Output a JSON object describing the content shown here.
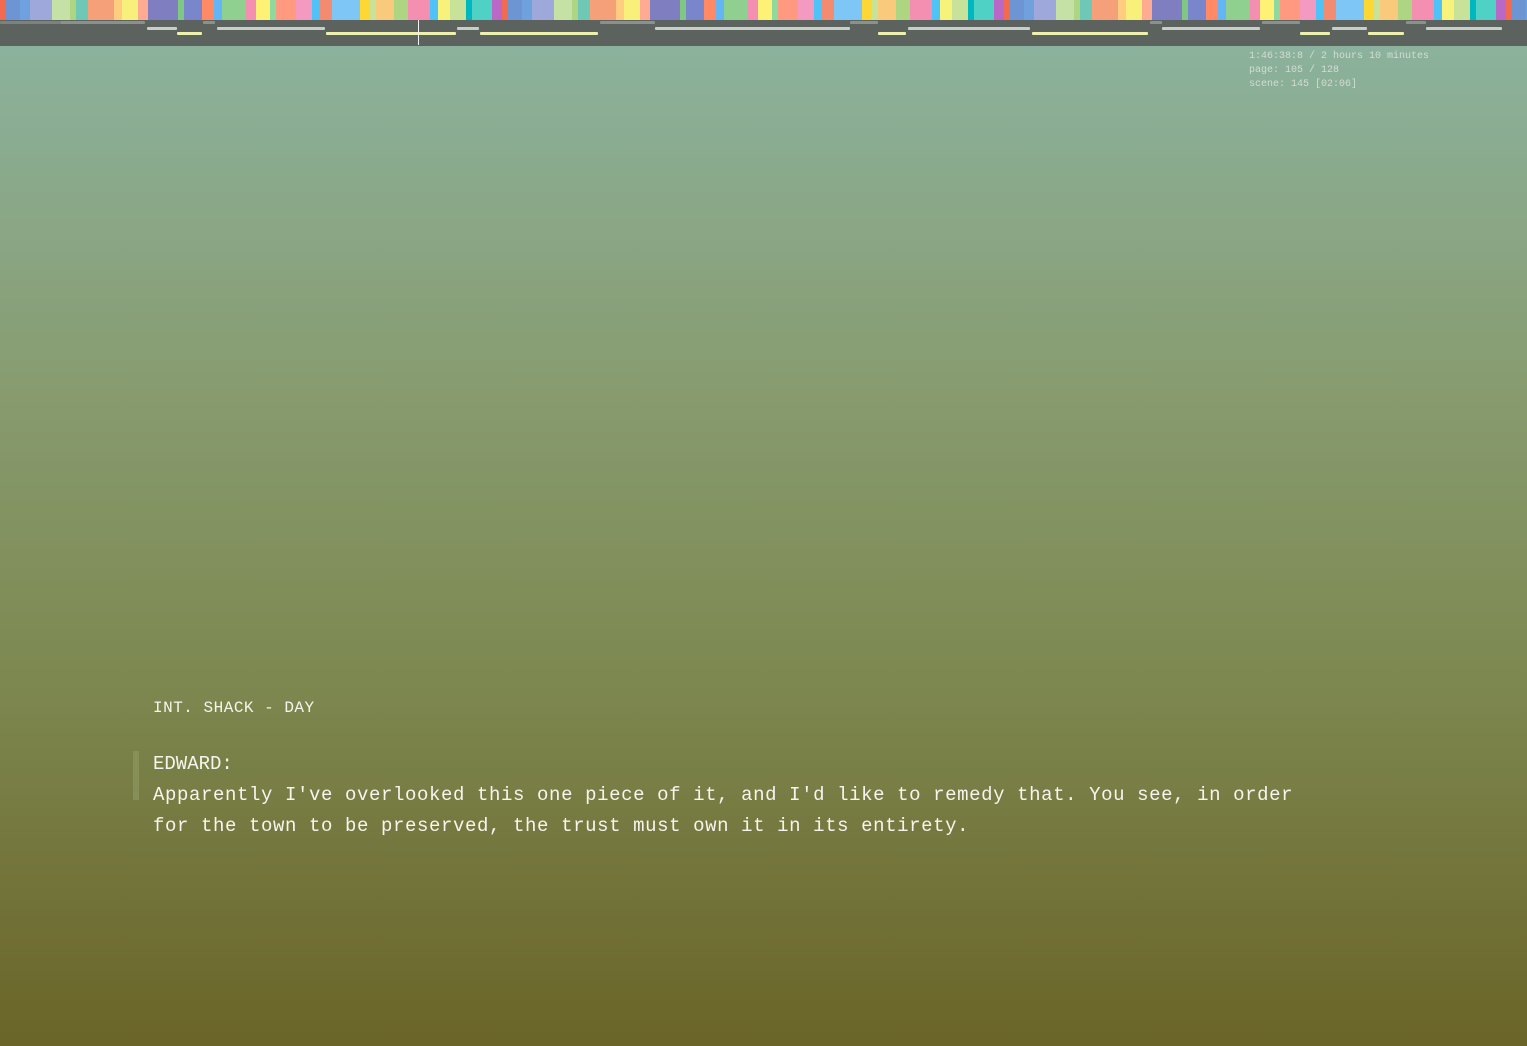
{
  "timeline": {
    "scene_colors": [
      "#f26b4f",
      "#f7f27a",
      "#c9e29a",
      "#f49ac1",
      "#8fcf8f",
      "#7f7ec0",
      "#6fc7b5",
      "#6e95d3",
      "#c9e29a",
      "#f9c97c",
      "#4fc3f7",
      "#f48fb1",
      "#81c784",
      "#f6a07a",
      "#6fa1de",
      "#00b6bf",
      "#aed581",
      "#f28b6f",
      "#fff176",
      "#7986cb",
      "#ffcc80",
      "#9fa8da",
      "#4fd1c5",
      "#f48fb1",
      "#7ec6f5",
      "#8fd99e",
      "#ff8a65",
      "#f8f07a",
      "#c5e1a5",
      "#ba68c8",
      "#4fc3f7",
      "#fdd835",
      "#ff9a80",
      "#64b5f6",
      "#ffab91",
      "#aed581"
    ],
    "playhead_progress": 0.2735
  },
  "status": {
    "time": "1:46:38:8 / 2 hours 10 minutes",
    "page": "page: 105 / 128",
    "scene": "scene: 145 [02:06]"
  },
  "scene": {
    "heading": "INT. SHACK - DAY",
    "speaker": "EDWARD:",
    "dialogue": "Apparently I've overlooked this one piece of it, and I'd like to remedy that. You see, in order for the town to be preserved, the trust must own it in its entirety."
  }
}
